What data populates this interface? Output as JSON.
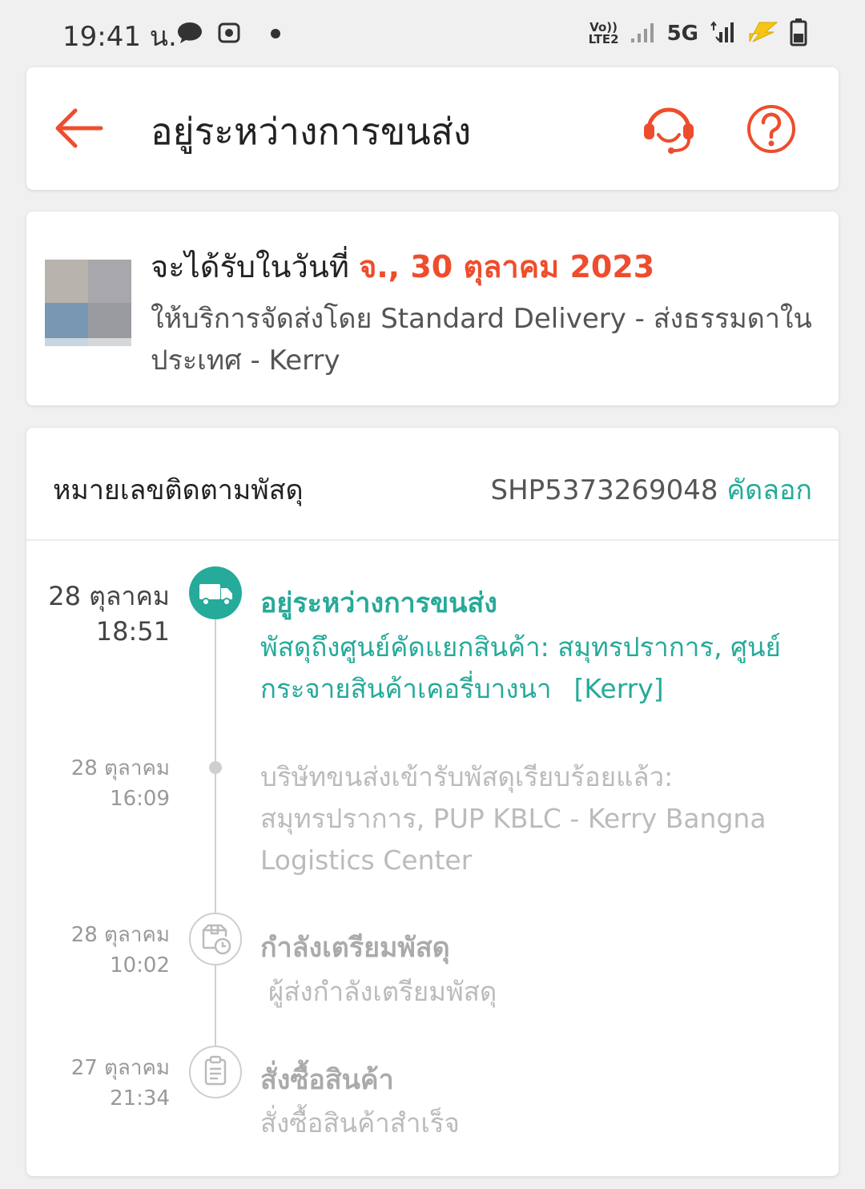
{
  "status_bar": {
    "time": "19:41 น.",
    "network_label": "5G",
    "volte_label": "Vo))\nLTE2"
  },
  "header": {
    "title": "อยู่ระหว่างการขนส่ง",
    "accent_color": "#ee4d2d"
  },
  "delivery": {
    "expected_prefix": "จะได้รับในวันที่",
    "expected_date": "จ., 30 ตุลาคม 2023",
    "service": "ให้บริการจัดส่งโดย Standard Delivery - ส่งธรรมดาในประเทศ - Kerry"
  },
  "tracking": {
    "label": "หมายเลขติดตามพัสดุ",
    "number": "SHP5373269048",
    "copy_label": "คัดลอก",
    "accent_color": "#26aa99"
  },
  "timeline": [
    {
      "date": "28 ตุลาคม",
      "time": "18:51",
      "title": "อยู่ระหว่างการขนส่ง",
      "description": "พัสดุถึงศูนย์คัดแยกสินค้า: สมุทรปราการ, ศูนย์กระจายสินค้าเคอรี่บางนา",
      "carrier": "[Kerry]",
      "icon": "truck-icon",
      "active": true
    },
    {
      "date": "28 ตุลาคม",
      "time": "16:09",
      "description": "บริษัทขนส่งเข้ารับพัสดุเรียบร้อยแล้ว: สมุทรปราการ, PUP KBLC - Kerry Bangna Logistics Center",
      "icon": "dot",
      "active": false
    },
    {
      "date": "28 ตุลาคม",
      "time": "10:02",
      "title": "กำลังเตรียมพัสดุ",
      "description": "ผู้ส่งกำลังเตรียมพัสดุ",
      "icon": "package-clock-icon",
      "active": false
    },
    {
      "date": "27 ตุลาคม",
      "time": "21:34",
      "title": "สั่งซื้อสินค้า",
      "description": "สั่งซื้อสินค้าสำเร็จ",
      "icon": "clipboard-icon",
      "active": false
    }
  ]
}
